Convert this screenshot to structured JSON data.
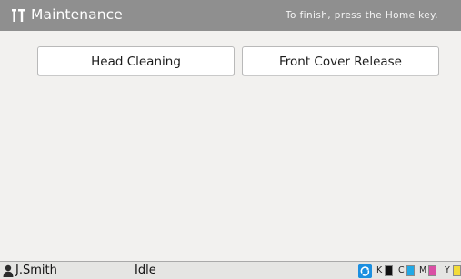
{
  "header": {
    "title": "Maintenance",
    "hint": "To finish, press the Home key.",
    "icon": "maintenance-tools-icon"
  },
  "buttons": {
    "head_cleaning": "Head Cleaning",
    "front_cover_release": "Front Cover Release"
  },
  "footer": {
    "user_name": "J.Smith",
    "user_icon": "user-icon",
    "status": "Idle",
    "sync_icon": "sync-icon",
    "inks": [
      {
        "label": "K",
        "color": "#111111"
      },
      {
        "label": "C",
        "color": "#21a9e6"
      },
      {
        "label": "M",
        "color": "#d94fa4"
      },
      {
        "label": "Y",
        "color": "#f3dc3a"
      }
    ]
  },
  "colors": {
    "header_bg": "#8f8f8f",
    "screen_bg": "#f2f1ef",
    "footer_bg": "#e5e5e3",
    "accent": "#1c8fe0"
  }
}
